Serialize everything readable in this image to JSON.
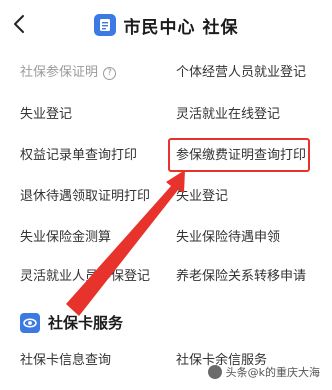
{
  "header": {
    "title": "市民中心  社保"
  },
  "items": {
    "left": [
      "社保参保证明",
      "失业登记",
      "权益记录单查询打印",
      "退休待遇领取证明打印",
      "失业保险金测算",
      "灵活就业人员参保登记"
    ],
    "right": [
      "个体经营人员就业登记",
      "灵活就业在线登记",
      "参保缴费证明查询打印",
      "失业登记",
      "失业保险待遇申领",
      "养老保险关系转移申请"
    ]
  },
  "section": {
    "title": "社保卡服务"
  },
  "card_items": {
    "left": "社保卡信息查询",
    "right": "社保卡余信服务"
  },
  "watermark": "头条@k的重庆大海",
  "colors": {
    "accent": "#3c79e3",
    "highlight": "#e8322c"
  },
  "icons": {
    "back": "chevron-left-icon",
    "title": "document-icon",
    "section": "eye-icon",
    "info": "info-icon"
  }
}
